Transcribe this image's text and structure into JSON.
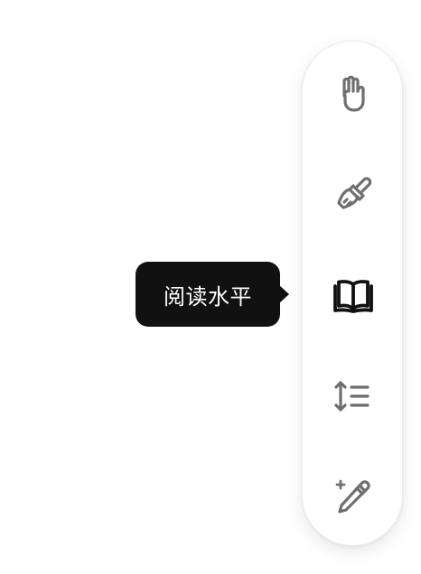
{
  "tooltip": {
    "text": "阅读水平"
  },
  "toolbar": {
    "items": [
      {
        "icon": "hand-icon",
        "active": false
      },
      {
        "icon": "brush-icon",
        "active": false
      },
      {
        "icon": "book-open-icon",
        "active": true
      },
      {
        "icon": "line-height-icon",
        "active": false
      },
      {
        "icon": "magic-pen-icon",
        "active": false
      }
    ]
  },
  "colors": {
    "icon_inactive": "#6f6f6f",
    "icon_active": "#111111",
    "tooltip_bg": "#111111",
    "tooltip_text": "#ffffff",
    "toolbar_bg": "#ffffff"
  }
}
